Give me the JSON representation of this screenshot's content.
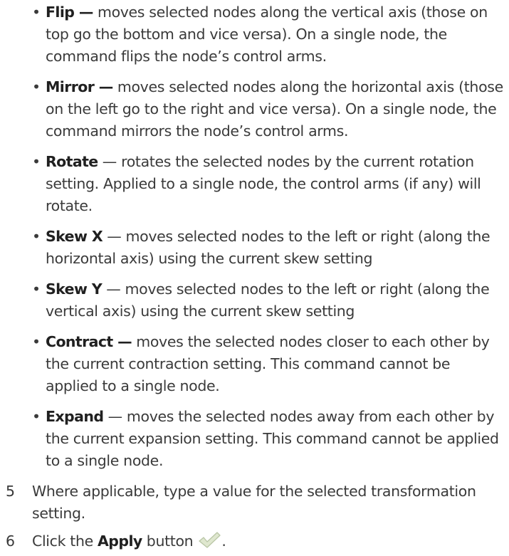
{
  "bullets": [
    {
      "term": "Flip —",
      "lines": [
        " moves selected nodes along the vertical axis (those on",
        "top go the bottom and vice versa). On a single node, the",
        "command flips the node’s control arms."
      ]
    },
    {
      "term": "Mirror —",
      "lines": [
        " moves selected nodes along the horizontal axis (those",
        "on the left go to the right and vice versa). On a single node, the",
        "command mirrors the node’s control arms."
      ]
    },
    {
      "term": "Rotate",
      "lines": [
        " — rotates the selected nodes by the current rotation",
        "setting. Applied to a single node, the control arms (if any) will",
        "rotate."
      ]
    },
    {
      "term": "Skew X",
      "lines": [
        " — moves selected nodes to the left or right (along the",
        "horizontal axis) using the current skew setting"
      ]
    },
    {
      "term": "Skew Y",
      "lines": [
        " — moves selected nodes to the left or right (along the",
        "vertical axis) using the current skew setting"
      ]
    },
    {
      "term": "Contract —",
      "lines": [
        " moves the selected nodes closer to each other by",
        "the current contraction setting. This command cannot be",
        "applied to a single node."
      ]
    },
    {
      "term": "Expand",
      "lines": [
        " — moves the selected nodes away from each other by",
        "the current expansion setting. This command cannot be applied",
        "to a single node."
      ]
    }
  ],
  "bullet_char": "•",
  "steps": [
    {
      "number": "5",
      "lines": [
        "Where applicable, type a value for the selected transformation",
        "setting."
      ]
    },
    {
      "number": "6",
      "prefix": "Click the ",
      "bold": "Apply",
      "suffix": " button",
      "end": "."
    }
  ],
  "icons": {
    "apply": "checkmark-icon"
  },
  "colors": {
    "text": "#3a3a3a",
    "term": "#202020",
    "icon_fill": "#d9e2c8",
    "icon_stroke": "#b8c4a4"
  }
}
